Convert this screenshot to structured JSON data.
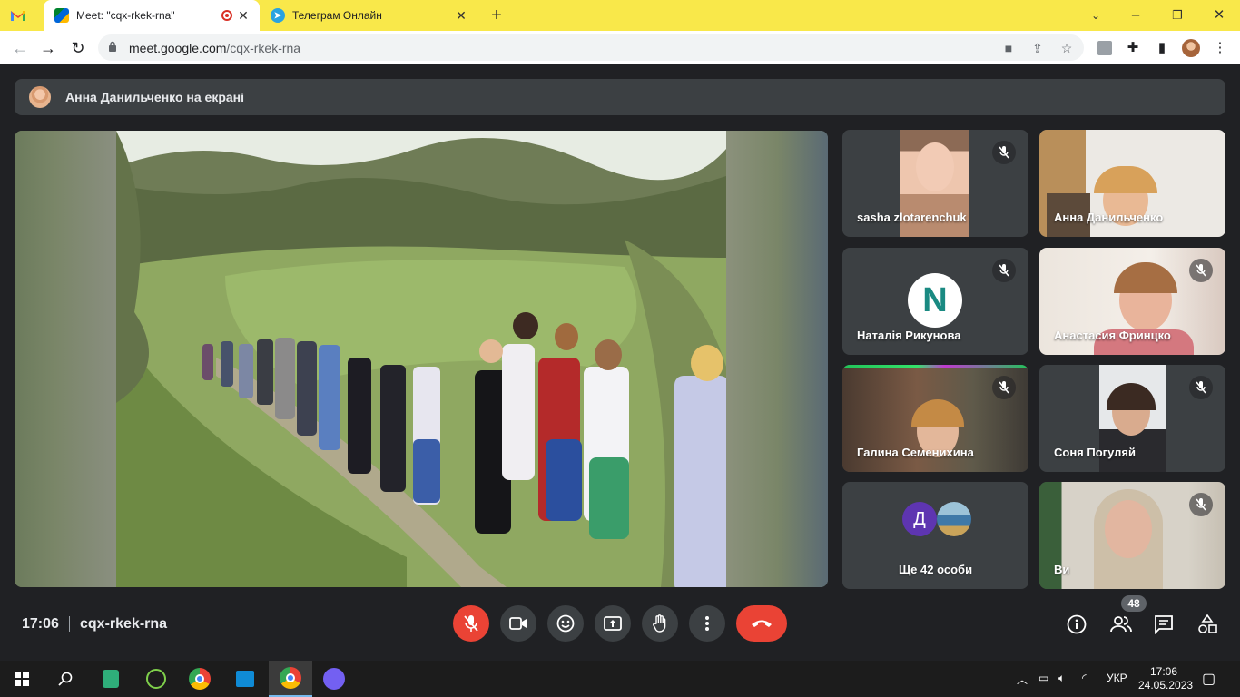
{
  "browser": {
    "tabs": [
      {
        "label": "Meet: \"cqx-rkek-rna\""
      },
      {
        "label": "Телеграм Онлайн"
      }
    ],
    "url_host": "meet.google.com",
    "url_path": "/cqx-rkek-rna"
  },
  "presenter": {
    "text": "Анна Данильченко на екрані"
  },
  "participants": [
    {
      "name": "sasha zlotarenchuk"
    },
    {
      "name": "Анна Данильченко"
    },
    {
      "name": "Наталія Рикунова",
      "avatar_letter": "N"
    },
    {
      "name": "Анастасия Фринцко"
    },
    {
      "name": "Галина Семенихина"
    },
    {
      "name": "Соня Погуляй"
    },
    {
      "name": "Ще 42 особи",
      "avatar_letter": "Д"
    },
    {
      "name": "Ви"
    }
  ],
  "meeting": {
    "time": "17:06",
    "code": "cqx-rkek-rna",
    "participant_count": "48"
  },
  "colors": {
    "hangup": "#ea4335",
    "tile_bg": "#3c4043",
    "page_bg": "#202124",
    "tab_bar": "#f9e84a"
  },
  "taskbar": {
    "lang": "УКР",
    "time": "17:06",
    "date": "24.05.2023"
  }
}
